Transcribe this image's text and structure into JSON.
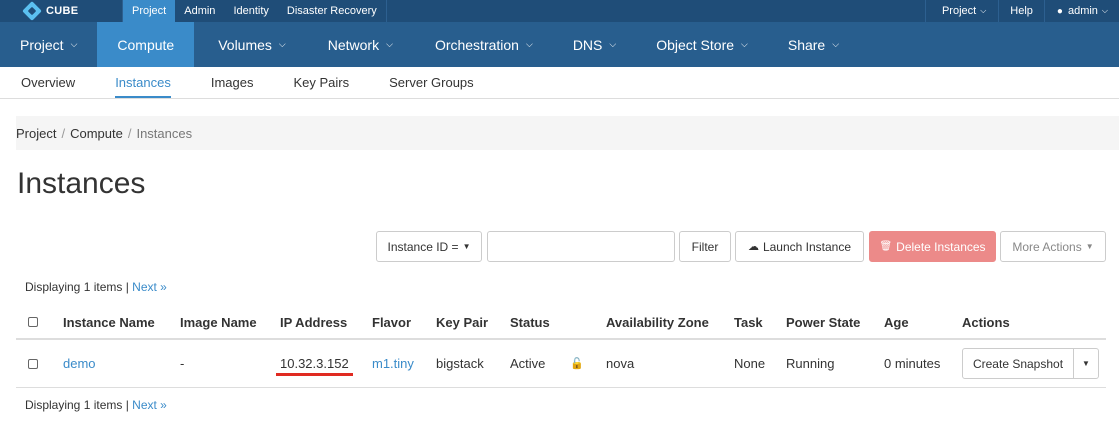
{
  "topbar": {
    "logo": "CUBE",
    "tabs": [
      "Project",
      "Admin",
      "Identity",
      "Disaster Recovery"
    ],
    "right": {
      "project": "Project",
      "help": "Help",
      "user": "admin"
    }
  },
  "mainnav": {
    "items": [
      "Project",
      "Compute",
      "Volumes",
      "Network",
      "Orchestration",
      "DNS",
      "Object Store",
      "Share"
    ]
  },
  "subnav": {
    "items": [
      "Overview",
      "Instances",
      "Images",
      "Key Pairs",
      "Server Groups"
    ]
  },
  "breadcrumb": {
    "items": [
      "Project",
      "Compute",
      "Instances"
    ],
    "sep": "/"
  },
  "page_title": "Instances",
  "toolbar": {
    "filter_type": "Instance ID =",
    "filter_value": "",
    "filter_label": "Filter",
    "launch_label": "Launch Instance",
    "delete_label": "Delete Instances",
    "more_label": "More Actions"
  },
  "displaying": {
    "text": "Displaying 1 items |",
    "next": "Next »"
  },
  "table": {
    "columns": [
      "Instance Name",
      "Image Name",
      "IP Address",
      "Flavor",
      "Key Pair",
      "Status",
      "Availability Zone",
      "Task",
      "Power State",
      "Age",
      "Actions"
    ],
    "rows": [
      {
        "name": "demo",
        "image": "-",
        "ip": "10.32.3.152",
        "flavor": "m1.tiny",
        "keypair": "bigstack",
        "status": "Active",
        "zone": "nova",
        "task": "None",
        "power": "Running",
        "age": "0 minutes",
        "action": "Create Snapshot"
      }
    ]
  },
  "colors": {
    "topbar": "#1f4d78",
    "mainnav": "#285e8e",
    "accent": "#3a8bc9",
    "danger": "#ec8a89",
    "highlight": "#e02a21"
  }
}
